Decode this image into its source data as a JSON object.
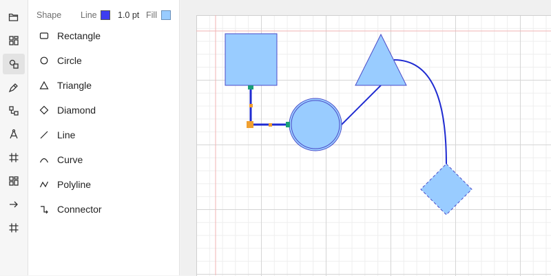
{
  "rail": {
    "items": [
      {
        "name": "open-folder-icon"
      },
      {
        "name": "layout-grid-icon"
      },
      {
        "name": "shapes-icon",
        "active": true
      },
      {
        "name": "pen-icon"
      },
      {
        "name": "flowchart-icon"
      },
      {
        "name": "compass-icon"
      },
      {
        "name": "grid-hash-icon"
      },
      {
        "name": "components-icon"
      },
      {
        "name": "arrow-right-icon"
      },
      {
        "name": "grid-hash-icon"
      }
    ]
  },
  "panel": {
    "section_label": "Shape",
    "line_label": "Line",
    "line_color": "#3d3df0",
    "line_width": "1.0 pt",
    "fill_label": "Fill",
    "fill_color": "#99ccff",
    "tools": [
      {
        "label": "Rectangle",
        "icon": "rectangle-icon"
      },
      {
        "label": "Circle",
        "icon": "circle-icon"
      },
      {
        "label": "Triangle",
        "icon": "triangle-icon"
      },
      {
        "label": "Diamond",
        "icon": "diamond-icon"
      },
      {
        "label": "Line",
        "icon": "line-icon"
      },
      {
        "label": "Curve",
        "icon": "curve-icon"
      },
      {
        "label": "Polyline",
        "icon": "polyline-icon"
      },
      {
        "label": "Connector",
        "icon": "connector-icon"
      }
    ]
  },
  "canvas": {
    "stroke_color": "#1f2bd1",
    "fill_color": "#99ccff",
    "handle_color": "#f0a030",
    "anchor_color": "#1a9e78"
  }
}
